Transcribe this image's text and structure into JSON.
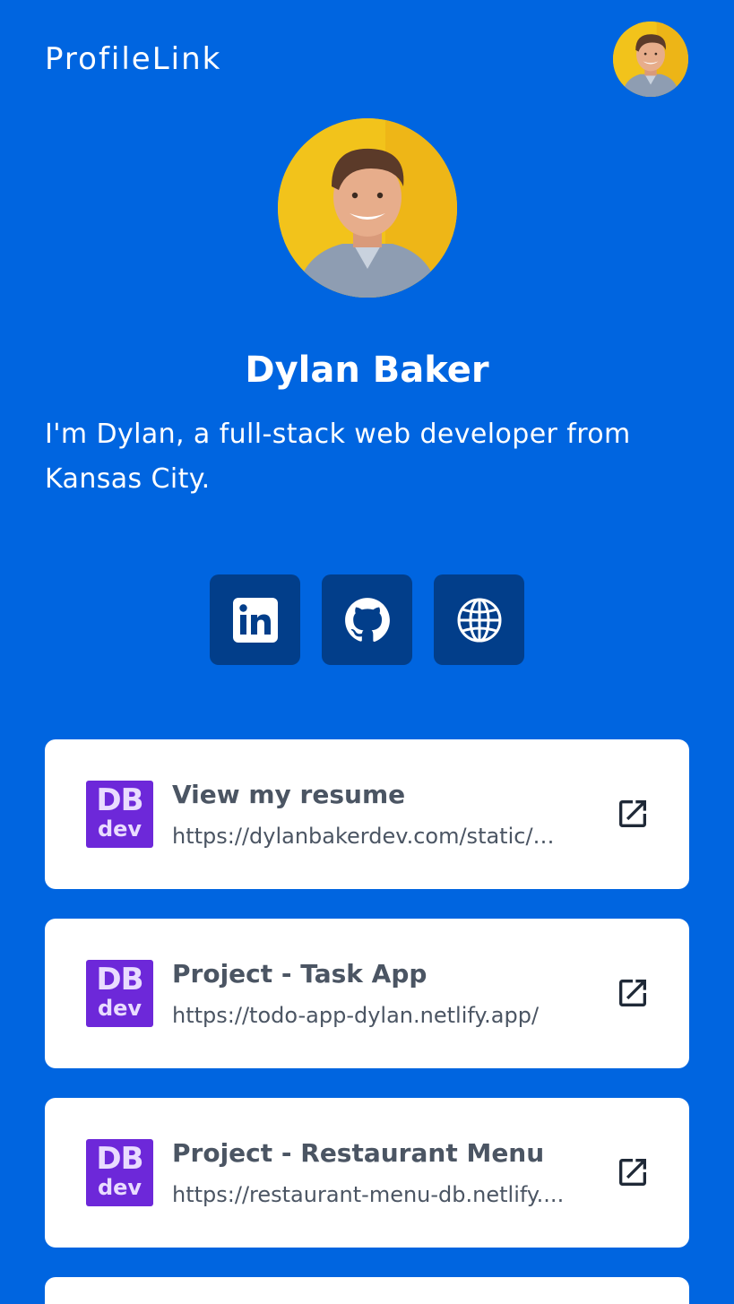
{
  "header": {
    "brand": "ProfileLink",
    "avatar_icon": "user-avatar"
  },
  "profile": {
    "name": "Dylan Baker",
    "bio": "I'm Dylan, a full-stack web developer from Kansas City."
  },
  "socials": [
    {
      "name": "LinkedIn",
      "icon": "linkedin-icon"
    },
    {
      "name": "GitHub",
      "icon": "github-icon"
    },
    {
      "name": "Website",
      "icon": "globe-icon"
    }
  ],
  "links": [
    {
      "logo_line1": "DB",
      "logo_line2": "dev",
      "title": "View my resume",
      "url": "https://dylanbakerdev.com/static/m..."
    },
    {
      "logo_line1": "DB",
      "logo_line2": "dev",
      "title": "Project - Task App",
      "url": "https://todo-app-dylan.netlify.app/"
    },
    {
      "logo_line1": "DB",
      "logo_line2": "dev",
      "title": "Project - Restaurant Menu",
      "url": "https://restaurant-menu-db.netlify...."
    }
  ],
  "colors": {
    "background": "#0065e0",
    "social_button": "#023e8a",
    "card": "#ffffff",
    "logo": "#6d28d9",
    "text_dark": "#4b5563"
  }
}
